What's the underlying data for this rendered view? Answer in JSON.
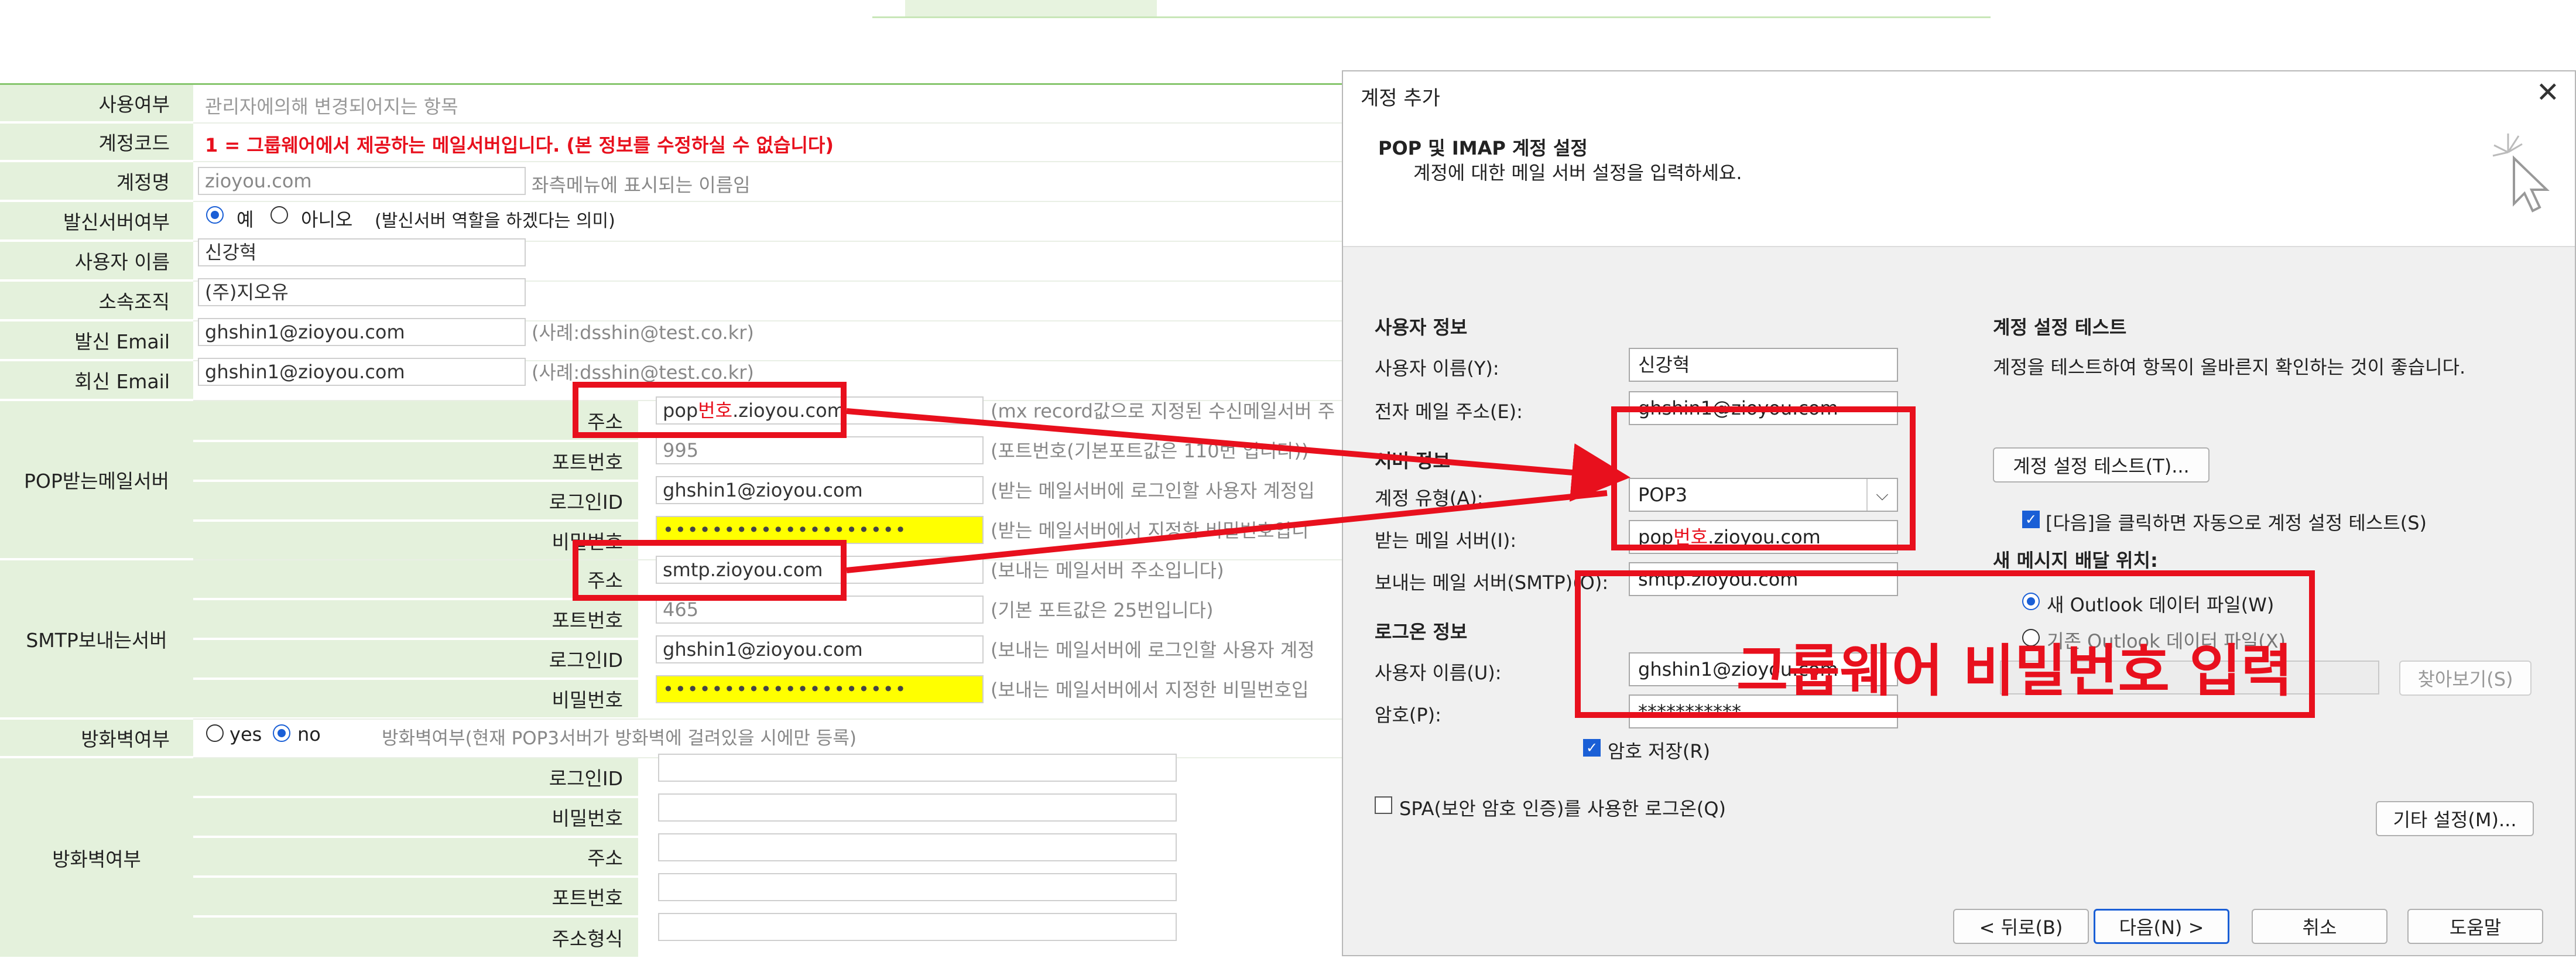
{
  "form": {
    "usage": {
      "label": "사용여부",
      "value": "관리자에의해 변경되어지는 항목"
    },
    "acct_code": {
      "label": "계정코드",
      "value": "1 = 그룹웨어에서 제공하는 메일서버입니다. (본 정보를 수정하실 수 없습니다)"
    },
    "acct_name": {
      "label": "계정명",
      "value": "zioyou.com",
      "hint": "좌측메뉴에 표시되는 이름임"
    },
    "send_server": {
      "label": "발신서버여부",
      "yes": "예",
      "no": "아니오",
      "hint": "(발신서버 역할을 하겠다는 의미)"
    },
    "user_name": {
      "label": "사용자 이름",
      "value": "신강혁"
    },
    "org": {
      "label": "소속조직",
      "value": "(주)지오유"
    },
    "from_email": {
      "label": "발신 Email",
      "value": "ghshin1@zioyou.com",
      "hint": "(사례:dsshin@test.co.kr)"
    },
    "reply_email": {
      "label": "회신 Email",
      "value": "ghshin1@zioyou.com",
      "hint": "(사례:dsshin@test.co.kr)"
    },
    "pop": {
      "label": "POP받는메일서버",
      "addr": {
        "label": "주소",
        "prefix": "pop",
        "highlight": "번호",
        "suffix": ".zioyou.com",
        "hint": "(mx record값으로 지정된 수신메일서버 주"
      },
      "port": {
        "label": "포트번호",
        "value": "995",
        "hint": "(포트번호(기본포트값은 110번 입니다))"
      },
      "login": {
        "label": "로그인ID",
        "value": "ghshin1@zioyou.com",
        "hint": "(받는 메일서버에 로그인할 사용자 계정입"
      },
      "pw": {
        "label": "비밀번호",
        "value": "••••••••••••••••••••",
        "hint": "(받는 메일서버에서 지정한 비밀번호입니"
      }
    },
    "smtp": {
      "label": "SMTP보내는서버",
      "addr": {
        "label": "주소",
        "value": "smtp.zioyou.com",
        "hint": "(보내는 메일서버 주소입니다)"
      },
      "port": {
        "label": "포트번호",
        "value": "465",
        "hint": "(기본 포트값은 25번입니다)"
      },
      "login": {
        "label": "로그인ID",
        "value": "ghshin1@zioyou.com",
        "hint": "(보내는 메일서버에 로그인할 사용자 계정"
      },
      "pw": {
        "label": "비밀번호",
        "value": "••••••••••••••••••••",
        "hint": "(보내는 메일서버에서 지정한 비밀번호입"
      }
    },
    "firewall": {
      "label": "방화벽여부",
      "yes": "yes",
      "no": "no",
      "hint": "방화벽여부(현재 POP3서버가 방화벽에 걸려있을 시에만 등록)"
    },
    "firewall2": {
      "label": "방화벽여부",
      "login": "로그인ID",
      "pw": "비밀번호",
      "addr": "주소",
      "port": "포트번호",
      "addr_type": "주소형식"
    }
  },
  "dialog": {
    "title": "계정 추가",
    "close": "✕",
    "header_title": "POP 및 IMAP 계정 설정",
    "header_sub": "계정에 대한 메일 서버 설정을 입력하세요.",
    "user_info": "사용자 정보",
    "user_name_label": "사용자 이름(Y):",
    "user_name_value": "신강혁",
    "email_label": "전자 메일 주소(E):",
    "email_value": "ghshin1@zioyou.com",
    "server_info": "서버 정보",
    "acct_type_label": "계정 유형(A):",
    "acct_type_value": "POP3",
    "incoming_label": "받는 메일 서버(I):",
    "incoming_prefix": "pop",
    "incoming_highlight": "번호",
    "incoming_suffix": ".zioyou.com",
    "outgoing_label": "보내는 메일 서버(SMTP)(O):",
    "outgoing_value": "smtp.zioyou.com",
    "login_info": "로그온 정보",
    "login_user_label": "사용자 이름(U):",
    "login_user_value": "ghshin1@zioyou.com",
    "password_label": "암호(P):",
    "password_value": "***********",
    "save_pw": "암호 저장(R)",
    "spa": "SPA(보안 암호 인증)를 사용한 로그온(Q)",
    "test_title": "계정 설정 테스트",
    "test_desc": "계정을 테스트하여 항목이 올바른지 확인하는 것이 좋습니다.",
    "test_button": "계정 설정 테스트(T)...",
    "auto_test": "[다음]을 클릭하면 자동으로 계정 설정 테스트(S)",
    "delivery_title": "새 메시지 배달 위치:",
    "new_file": "새 Outlook 데이터 파일(W)",
    "existing_file": "기존 Outlook 데이터 파일(X)",
    "browse": "찾아보기(S)",
    "more_settings": "기타 설정(M)...",
    "back": "< 뒤로(B)",
    "next": "다음(N) >",
    "cancel": "취소",
    "help": "도움말",
    "annotation": "그룹웨어 비밀번호 입력"
  }
}
